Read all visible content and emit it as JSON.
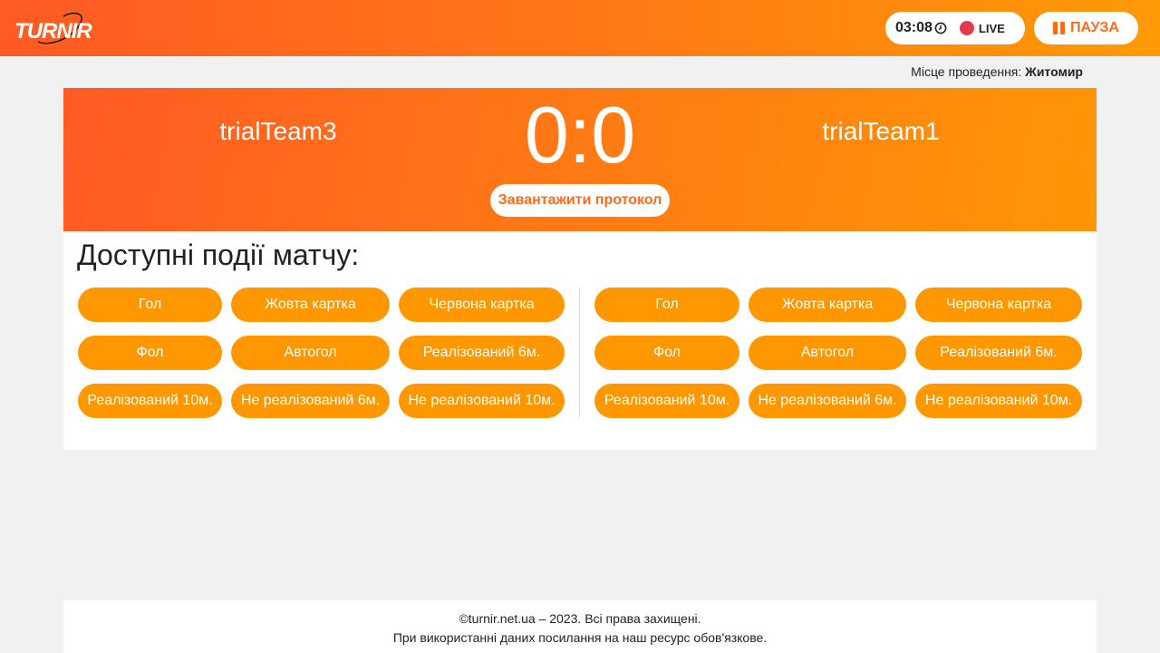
{
  "header": {
    "logo_text": "TURNIR",
    "timer": "03:08",
    "clock_icon": "clock-icon",
    "live_label": "LIVE",
    "live_color": "#e23b4e",
    "pause_label": "ПАУЗА",
    "gradient_start": "#ff5a24",
    "gradient_end": "#ff9a06"
  },
  "venue": {
    "label": "Місце проведення: ",
    "value": "Житомир"
  },
  "match": {
    "team_left": "trialTeam3",
    "team_right": "trialTeam1",
    "score": "0:0",
    "protocol_button": "Завантажити протокол"
  },
  "events": {
    "title": "Доступні події матчу:",
    "button_color": "#ff9800",
    "left": [
      "Гол",
      "Жовта картка",
      "Червона картка",
      "Фол",
      "Автогол",
      "Реалізований 6м.",
      "Реалізований 10м.",
      "Не реалізований 6м.",
      "Не реалізований 10м."
    ],
    "right": [
      "Гол",
      "Жовта картка",
      "Червона картка",
      "Фол",
      "Автогол",
      "Реалізований 6м.",
      "Реалізований 10м.",
      "Не реалізований 6м.",
      "Не реалізований 10м."
    ]
  },
  "footer": {
    "line1": "©turnir.net.ua – 2023. Всі права захищені.",
    "line2": "При використанні даних посилання на наш ресурс обов'язкове."
  }
}
